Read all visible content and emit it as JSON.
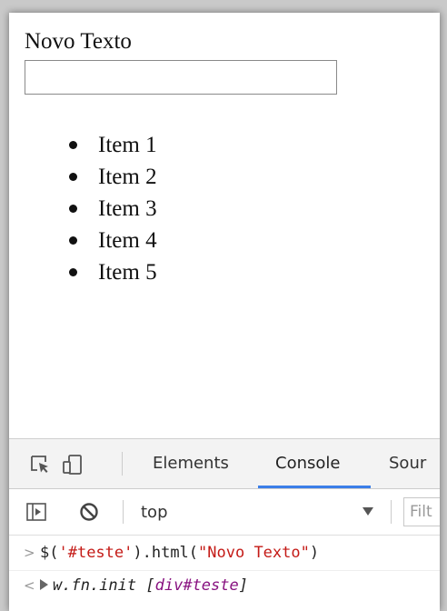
{
  "page": {
    "title": "Novo Texto",
    "input_value": "",
    "items": [
      "Item 1",
      "Item 2",
      "Item 3",
      "Item 4",
      "Item 5"
    ]
  },
  "devtools": {
    "tabs": [
      "Elements",
      "Console",
      "Sour"
    ],
    "active_tab": "Console",
    "context": "top",
    "filter_placeholder": "Filt",
    "console": {
      "input": {
        "prompt": ">",
        "code_prefix": "$(",
        "selector": "'#teste'",
        "code_mid": ").html(",
        "argument": "\"Novo Texto\"",
        "code_suffix": ")"
      },
      "output": {
        "prompt": "<",
        "constructor": "w.fn.init",
        "open_bracket": "[",
        "node": "div#teste",
        "close_bracket": "]"
      }
    },
    "accent_color": "#3b7ee8"
  }
}
